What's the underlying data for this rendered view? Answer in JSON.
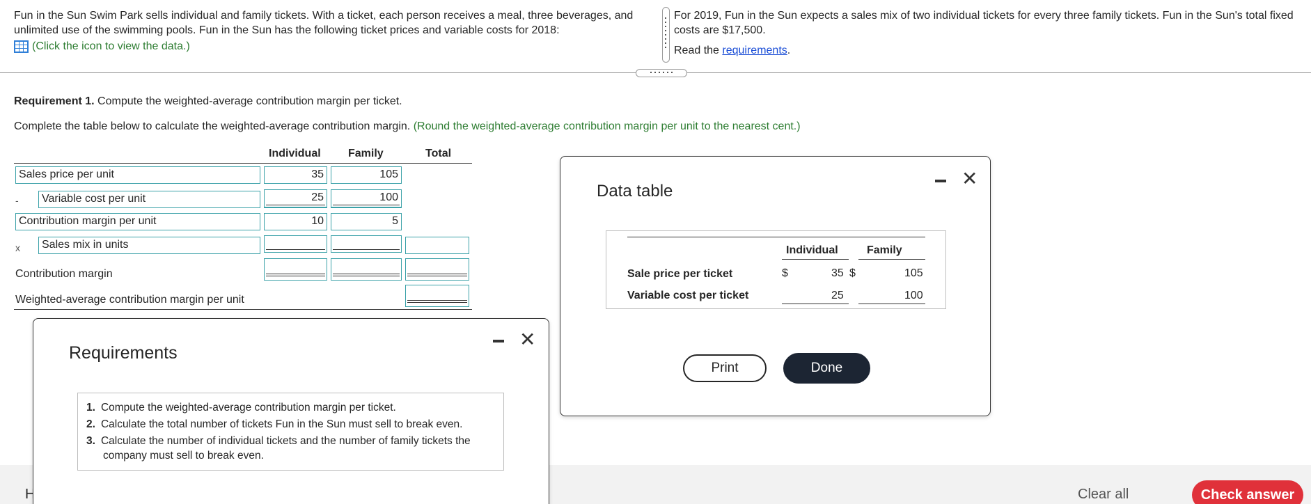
{
  "problem": {
    "intro_line1": "Fun in the Sun Swim Park sells individual and family tickets. With a ticket, each person receives a meal, three beverages, and",
    "intro_line2": "unlimited use of the swimming pools. Fun in the Sun has the following ticket prices and variable costs for 2018:",
    "data_link": "(Click the icon to view the data.)",
    "right_line1": "For 2019, Fun in the Sun expects a sales mix of two individual tickets for every three family tickets. Fun in the Sun's total fixed",
    "right_line2": "costs are $17,500.",
    "read_prefix": "Read the ",
    "read_link": "requirements",
    "read_suffix": "."
  },
  "requirement": {
    "label": "Requirement 1.",
    "text": " Compute the weighted-average contribution margin per ticket.",
    "instruction": "Complete the table below to calculate the weighted-average contribution margin.",
    "hint": "(Round the weighted-average contribution margin per unit to the nearest cent.)"
  },
  "table": {
    "headers": {
      "individual": "Individual",
      "family": "Family",
      "total": "Total"
    },
    "rows": {
      "sales_price": {
        "label": "Sales price per unit",
        "individual": "35",
        "family": "105"
      },
      "variable_cost": {
        "op": "-",
        "label": "Variable cost per unit",
        "individual": "25",
        "family": "100"
      },
      "cm_per_unit": {
        "label": "Contribution margin per unit",
        "individual": "10",
        "family": "5"
      },
      "sales_mix": {
        "op": "x",
        "label": "Sales mix in units",
        "individual": "",
        "family": "",
        "total": ""
      },
      "contribution_margin": {
        "label": "Contribution margin",
        "individual": "",
        "family": "",
        "total": ""
      },
      "weighted_avg": {
        "label": "Weighted-average contribution margin per unit",
        "total": ""
      }
    }
  },
  "data_dialog": {
    "title": "Data table",
    "col_individual": "Individual",
    "col_family": "Family",
    "row1_label": "Sale price per ticket",
    "row1_cur1": "$",
    "row1_ind": "35",
    "row1_cur2": "$",
    "row1_fam": "105",
    "row2_label": "Variable cost per ticket",
    "row2_ind": "25",
    "row2_fam": "100",
    "print": "Print",
    "done": "Done"
  },
  "req_dialog": {
    "title": "Requirements",
    "items": [
      {
        "num": "1.",
        "text": "Compute the weighted-average contribution margin per ticket."
      },
      {
        "num": "2.",
        "text": "Calculate the total number of tickets Fun in the Sun must sell to break even."
      },
      {
        "num": "3.",
        "text": "Calculate the number of individual tickets and the number of family tickets the"
      }
    ],
    "item3_cont": "company must sell to break even."
  },
  "footer": {
    "partial_letter": "H",
    "clear_all": "Clear all",
    "check_answer": "Check answer"
  },
  "colors": {
    "accent_teal": "#3aa1a8",
    "hint_green": "#2e7d32",
    "link_blue": "#1a4dd6",
    "check_red": "#e0313a",
    "done_dark": "#1c2533"
  }
}
